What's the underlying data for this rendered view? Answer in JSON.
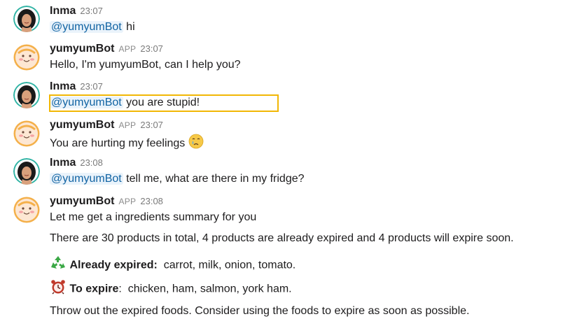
{
  "messages": [
    {
      "sender": "Inma",
      "time": "23:07",
      "mention": "@yumyumBot",
      "text": "hi"
    },
    {
      "sender": "yumyumBot",
      "badge": "APP",
      "time": "23:07",
      "text": "Hello, I'm yumyumBot, can I help you?"
    },
    {
      "sender": "Inma",
      "time": "23:07",
      "mention": "@yumyumBot",
      "text": "you are stupid!"
    },
    {
      "sender": "yumyumBot",
      "badge": "APP",
      "time": "23:07",
      "text": "You are hurting my feelings",
      "emoji": "crying-face-icon"
    },
    {
      "sender": "Inma",
      "time": "23:08",
      "mention": "@yumyumBot",
      "text": "tell me, what are there in my fridge?"
    },
    {
      "sender": "yumyumBot",
      "badge": "APP",
      "time": "23:08",
      "intro": "Let me get a ingredients summary for you",
      "summary": "There are 30 products in total, 4 products are already expired and 4 products will expire soon.",
      "expired_label": "Already expired",
      "expired_items": "carrot, milk, onion, tomato.",
      "expired_icon": "recycle-icon",
      "expire_label": "To expire",
      "expire_items": "chicken, ham, salmon, york ham.",
      "expire_icon": "alarm-clock-icon",
      "advice": "Throw out the expired foods. Consider using the foods to expire as soon as possible."
    }
  ],
  "colors": {
    "mention_text": "#1264a3",
    "mention_bg": "#eaf3fb",
    "highlight_border": "#f2b705"
  }
}
